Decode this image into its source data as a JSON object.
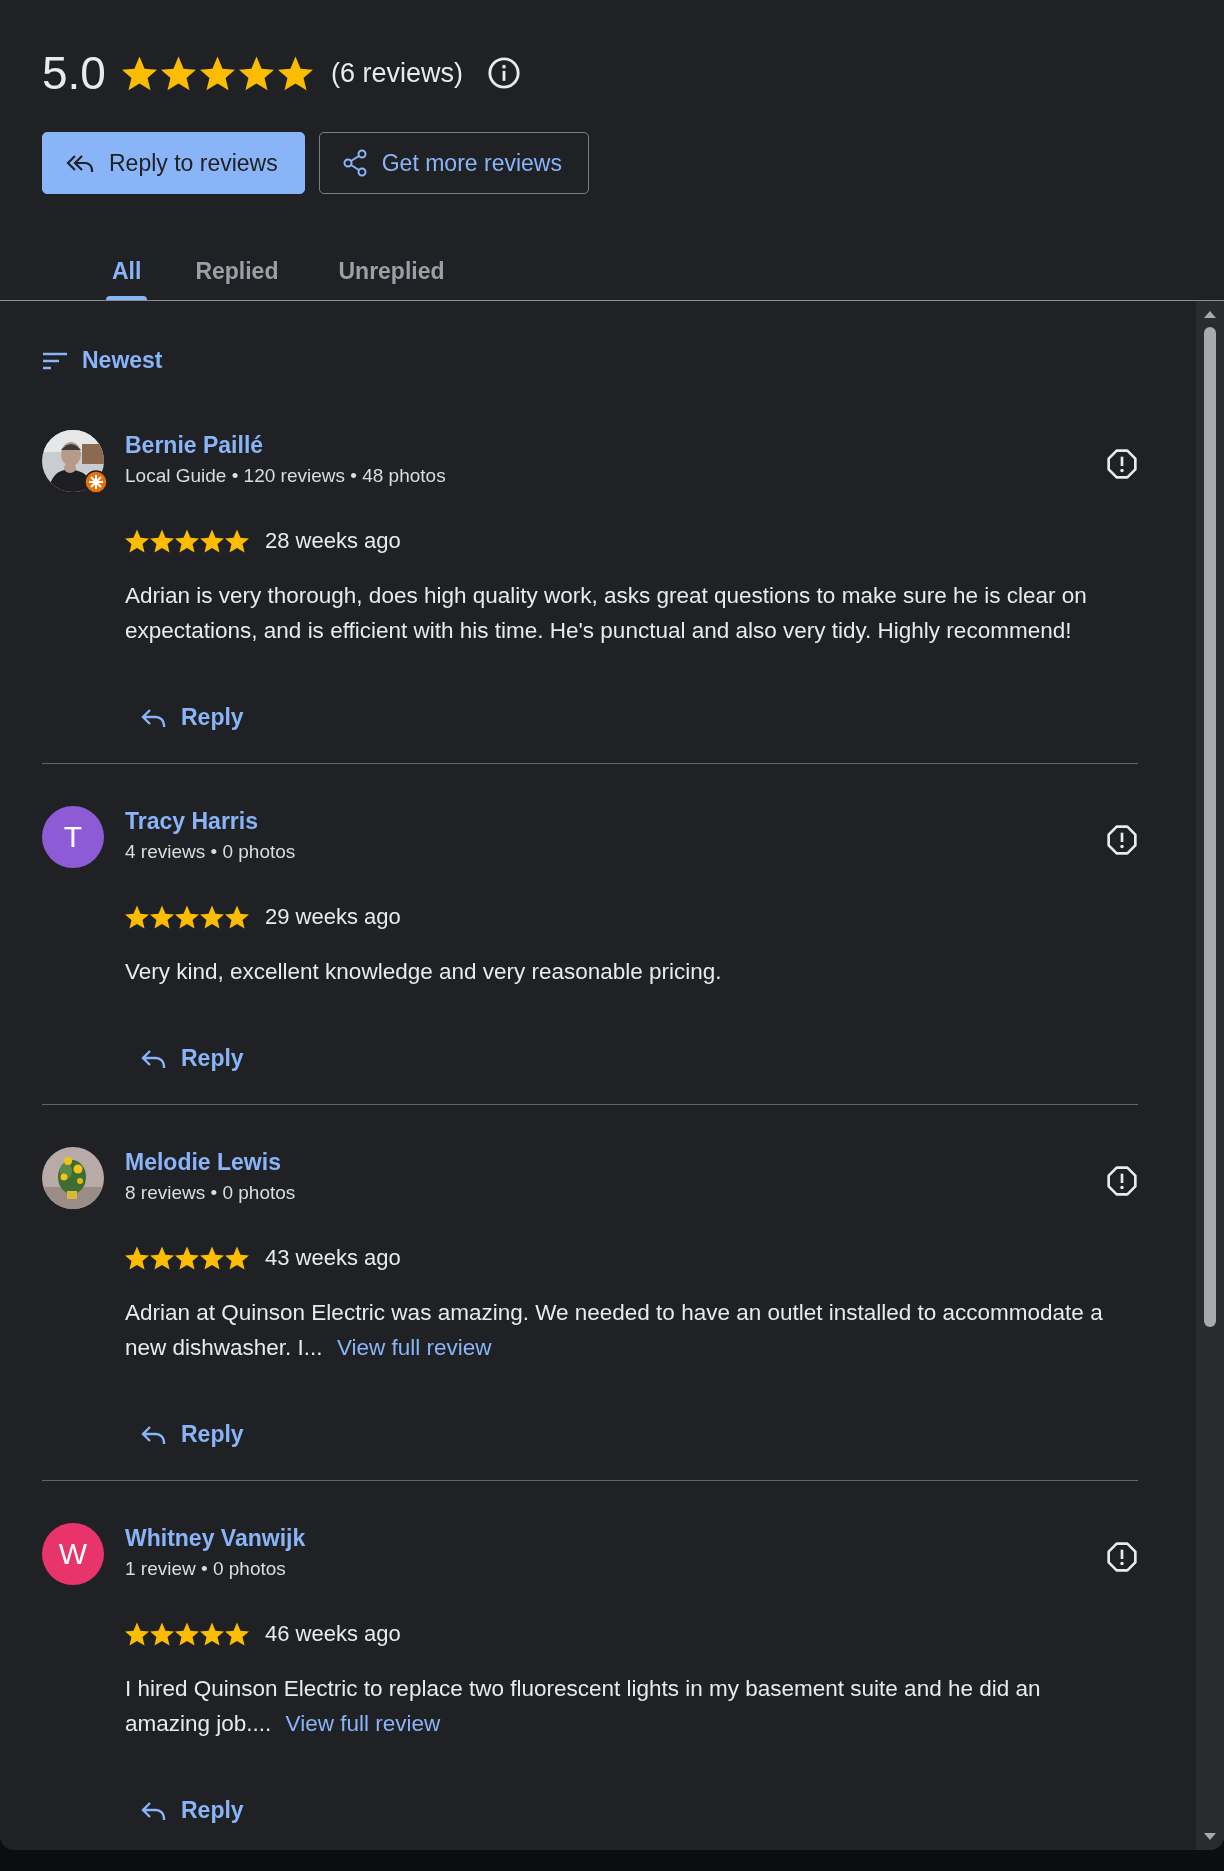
{
  "summary": {
    "rating": "5.0",
    "stars": 5,
    "count": "(6 reviews)"
  },
  "buttons": [
    {
      "label": "Reply to reviews",
      "kind": "filled"
    },
    {
      "label": "Get more reviews",
      "kind": "outlined"
    }
  ],
  "tabs": [
    {
      "label": "All",
      "selected": true
    },
    {
      "label": "Replied",
      "selected": false
    },
    {
      "label": "Unreplied",
      "selected": false
    }
  ],
  "sort": {
    "label": "Newest"
  },
  "reviews": [
    {
      "name": "Bernie Paillé",
      "local_guide": true,
      "meta": "Local Guide • 120 reviews • 48 photos",
      "stars": 5,
      "time": "28 weeks ago",
      "text": "Adrian is very thorough, does high quality work, asks great questions to make sure he is clear on expectations, and is efficient with his time. He's punctual and also very tidy. Highly recommend!",
      "reply": "Reply"
    },
    {
      "name": "Tracy Harris",
      "avatar": {
        "kind": "letter",
        "letter": "T",
        "color": "#8e5bd6"
      },
      "local_guide": false,
      "meta": "4 reviews • 0 photos",
      "stars": 5,
      "time": "29 weeks ago",
      "text": "Very kind, excellent knowledge and very reasonable pricing.",
      "reply": "Reply"
    },
    {
      "name": "Melodie Lewis",
      "local_guide": false,
      "meta": "8 reviews • 0 photos",
      "stars": 5,
      "time": "43 weeks ago",
      "text": "Adrian at Quinson Electric was amazing. We needed to have an outlet installed to accommodate a new dishwasher. I...",
      "more_link": "View full review",
      "reply": "Reply"
    },
    {
      "name": "Whitney Vanwijk",
      "avatar": {
        "kind": "letter",
        "letter": "W",
        "color": "#e8336b"
      },
      "local_guide": false,
      "meta": "1 review • 0 photos",
      "stars": 5,
      "time": "46 weeks ago",
      "text": "I hired Quinson Electric to replace two fluorescent lights in my basement suite and he did an amazing job....",
      "more_link": "View full review",
      "reply": "Reply"
    }
  ]
}
